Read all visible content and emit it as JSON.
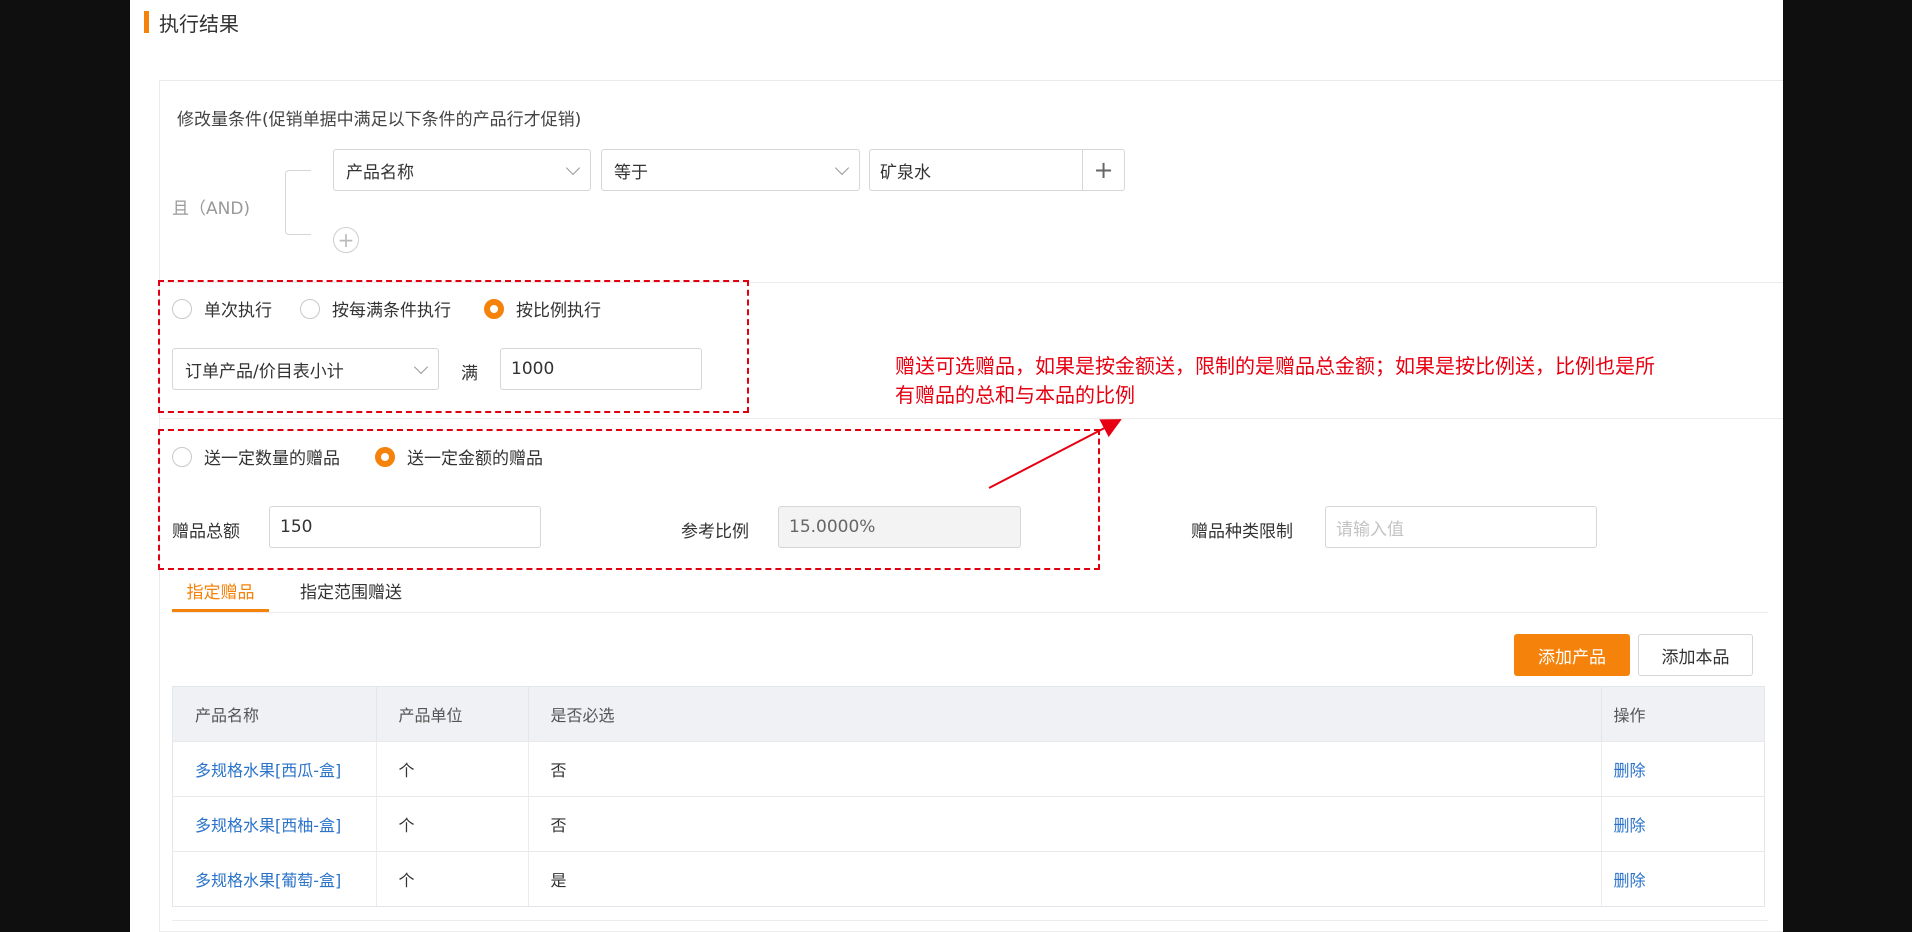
{
  "section": {
    "title": "执行结果"
  },
  "condition": {
    "title": "修改量条件(促销单据中满足以下条件的产品行才促销)",
    "logic_label": "且（AND)",
    "field": "产品名称",
    "operator": "等于",
    "value": "矿泉水",
    "add_symbol": "+"
  },
  "execution": {
    "options": [
      "单次执行",
      "按每满条件执行",
      "按比例执行"
    ],
    "selected": "按比例执行",
    "basis_select": "订单产品/价目表小计",
    "full_label": "满",
    "full_value": "1000"
  },
  "annotation": {
    "text": "赠送可选赠品，如果是按金额送，限制的是赠品总金额；如果是按比例送，比例也是所有赠品的总和与本品的比例",
    "color": "#e60012"
  },
  "gift_mode": {
    "options": [
      "送一定数量的赠品",
      "送一定金额的赠品"
    ],
    "selected": "送一定金额的赠品",
    "total_label": "赠品总额",
    "total_value": "150",
    "ratio_label": "参考比例",
    "ratio_value": "15.0000%",
    "kind_label": "赠品种类限制",
    "kind_placeholder": "请输入值"
  },
  "tabs": [
    {
      "label": "指定赠品",
      "active": true
    },
    {
      "label": "指定范围赠送",
      "active": false
    }
  ],
  "buttons": {
    "add_product": "添加产品",
    "add_self": "添加本品"
  },
  "table": {
    "columns": [
      "产品名称",
      "产品单位",
      "是否必选",
      "操作"
    ],
    "rows": [
      {
        "name": "多规格水果[西瓜-盒]",
        "unit": "个",
        "required": "否",
        "action": "删除"
      },
      {
        "name": "多规格水果[西柚-盒]",
        "unit": "个",
        "required": "否",
        "action": "删除"
      },
      {
        "name": "多规格水果[葡萄-盒]",
        "unit": "个",
        "required": "是",
        "action": "删除"
      }
    ]
  },
  "colors": {
    "accent": "#f5830b",
    "link": "#2a73c9",
    "annotation": "#e60012"
  }
}
